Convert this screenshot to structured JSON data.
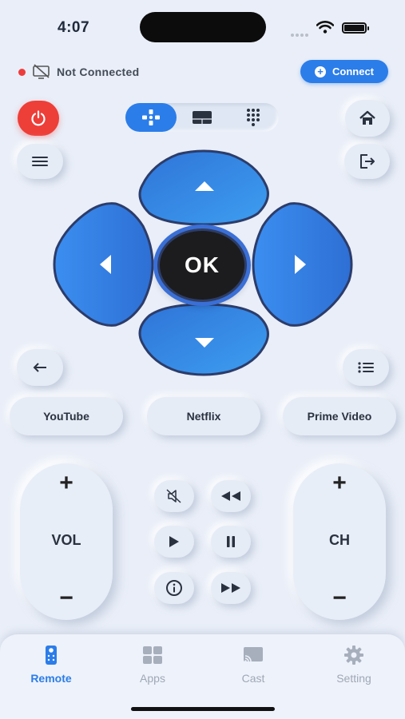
{
  "status_bar": {
    "time": "4:07"
  },
  "connection": {
    "status_text": "Not Connected",
    "connect_label": "Connect",
    "status_color": "#ee3b3b"
  },
  "controls": {
    "ok_label": "OK",
    "mode_tabs": [
      "gamepad-icon",
      "touchpad-icon",
      "keypad-icon"
    ]
  },
  "quick_apps": [
    "YouTube",
    "Netflix",
    "Prime Video"
  ],
  "rockers": {
    "volume": {
      "label": "VOL",
      "plus": "+",
      "minus": "−"
    },
    "channel": {
      "label": "CH",
      "plus": "+",
      "minus": "−"
    }
  },
  "tabbar": {
    "items": [
      {
        "label": "Remote",
        "icon": "remote-icon",
        "active": true
      },
      {
        "label": "Apps",
        "icon": "apps-grid-icon",
        "active": false
      },
      {
        "label": "Cast",
        "icon": "cast-icon",
        "active": false
      },
      {
        "label": "Setting",
        "icon": "gear-icon",
        "active": false
      }
    ]
  },
  "colors": {
    "accent": "#2b7de9",
    "power": "#ee3e38",
    "background": "#e9eef8"
  }
}
